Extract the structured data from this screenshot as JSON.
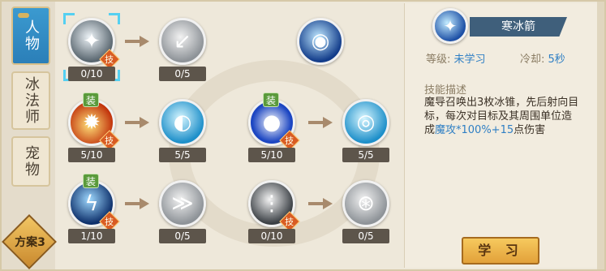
{
  "tabs": [
    {
      "label": "人物",
      "active": true
    },
    {
      "label": "冰法师",
      "active": false
    },
    {
      "label": "宠物",
      "active": false
    }
  ],
  "plan": {
    "label": "方案3"
  },
  "skills": {
    "row1": [
      {
        "level": "0/10",
        "badge_ji": "技",
        "icon": "ice-shards-icon"
      },
      {
        "level": "0/5",
        "icon": "arrow-plus-icon"
      },
      {
        "icon": "blue-orb-icon"
      }
    ],
    "row2": [
      {
        "level": "5/10",
        "badge_zhuang": "装",
        "badge_ji": "技",
        "icon": "fire-burst-icon"
      },
      {
        "level": "5/5",
        "icon": "wave-icon"
      },
      {
        "level": "5/10",
        "badge_zhuang": "装",
        "badge_ji": "技",
        "icon": "energy-ball-icon"
      },
      {
        "level": "5/5",
        "icon": "vortex-icon"
      }
    ],
    "row3": [
      {
        "level": "1/10",
        "badge_zhuang": "装",
        "badge_ji": "技",
        "icon": "lightning-icon"
      },
      {
        "level": "0/5",
        "icon": "claw-plus-icon"
      },
      {
        "level": "0/10",
        "badge_ji": "技",
        "icon": "ice-rain-icon"
      },
      {
        "level": "0/5",
        "icon": "spin-orb-icon"
      }
    ]
  },
  "detail": {
    "name": "寒冰箭",
    "level_label": "等级:",
    "level_value": "未学习",
    "cooldown_label": "冷却:",
    "cooldown_value": "5秒",
    "desc_title": "技能描述",
    "desc_part1": "魔导召唤出3枚冰锥，先后射向目标，每次对目标及其周围单位造成",
    "desc_highlight": "魔攻*100%+15",
    "desc_part2": "点伤害",
    "learn_button": "学 习"
  },
  "colors": {
    "accent_blue": "#2f7fc4",
    "tab_active": "#2b7fb8",
    "button_gold": "#e2a13a"
  }
}
